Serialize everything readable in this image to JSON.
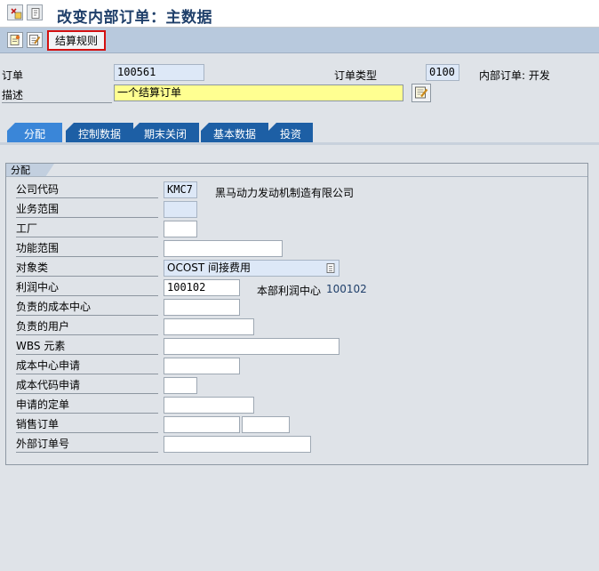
{
  "window": {
    "title": "改变内部订单：主数据"
  },
  "icons": {
    "sys1": "display-change-icon",
    "sys2": "other-object-icon",
    "tb1": "new-document-icon",
    "tb2": "edit-document-icon",
    "desc_edit": "long-text-edit-icon",
    "dropdown": "dropdown-list-icon"
  },
  "toolbar": {
    "settlement_rule": "结算规则"
  },
  "header": {
    "order_label": "订单",
    "order_value": "100561",
    "order_type_label": "订单类型",
    "order_type_value": "0100",
    "order_type_text": "内部订单: 开发",
    "description_label": "描述",
    "description_value": "一个结算订单"
  },
  "tabs": [
    "分配",
    "控制数据",
    "期末关闭",
    "基本数据",
    "投资"
  ],
  "group": {
    "title": "分配",
    "rows": [
      {
        "label": "公司代码",
        "value": "KMC7",
        "text": "黑马动力发动机制造有限公司"
      },
      {
        "label": "业务范围",
        "value": ""
      },
      {
        "label": "工厂",
        "value": ""
      },
      {
        "label": "功能范围",
        "value": ""
      },
      {
        "label": "对象类",
        "value": "OCOST 间接费用"
      },
      {
        "label": "利润中心",
        "value": "100102",
        "text_label": "本部利润中心",
        "text_value": "100102"
      },
      {
        "label": "负责的成本中心",
        "value": ""
      },
      {
        "label": "负责的用户",
        "value": ""
      },
      {
        "label": "WBS 元素",
        "value": ""
      },
      {
        "label": "成本中心申请",
        "value": ""
      },
      {
        "label": "成本代码申请",
        "value": ""
      },
      {
        "label": "申请的定单",
        "value": ""
      },
      {
        "label": "销售订单",
        "value": "",
        "value2": ""
      },
      {
        "label": "外部订单号",
        "value": ""
      }
    ]
  },
  "colors": {
    "toolbar": "#b8c9dd",
    "tab": "#1d5fa5",
    "tab_active": "#3a86d8",
    "highlight": "#d41010",
    "required_field": "#ffff91"
  }
}
